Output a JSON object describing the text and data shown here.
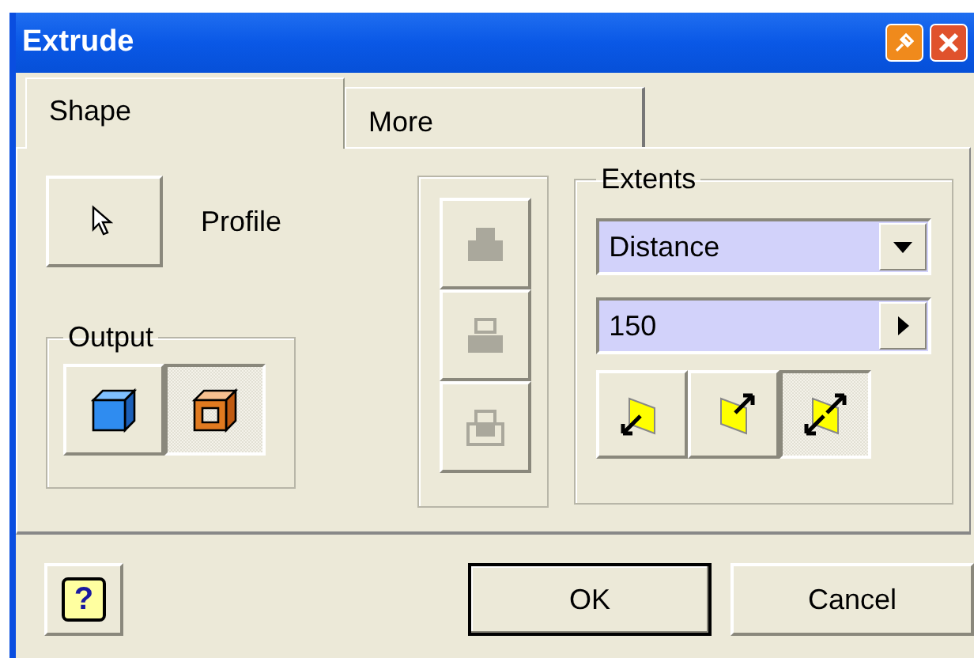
{
  "window": {
    "title": "Extrude"
  },
  "tabs": [
    {
      "label": "Shape",
      "selected": true
    },
    {
      "label": "More",
      "selected": false
    }
  ],
  "profile": {
    "label": "Profile"
  },
  "output": {
    "title": "Output",
    "buttons": [
      {
        "kind": "solid",
        "selected": false
      },
      {
        "kind": "surface",
        "selected": true
      }
    ]
  },
  "operation_buttons": [
    {
      "kind": "join",
      "disabled": true
    },
    {
      "kind": "cut",
      "disabled": true
    },
    {
      "kind": "intersect",
      "disabled": true
    }
  ],
  "extents": {
    "title": "Extents",
    "type": "Distance",
    "distance": "150",
    "direction_buttons": [
      {
        "kind": "one",
        "selected": false
      },
      {
        "kind": "two",
        "selected": false
      },
      {
        "kind": "symmetric",
        "selected": true
      }
    ]
  },
  "footer": {
    "help": "?",
    "ok": "OK",
    "cancel": "Cancel"
  }
}
